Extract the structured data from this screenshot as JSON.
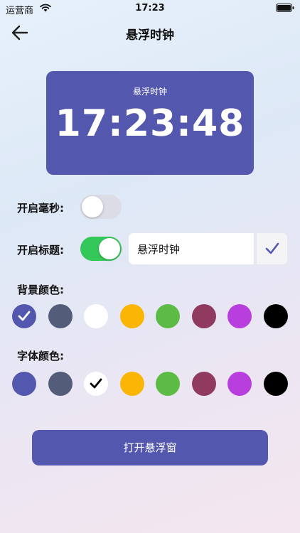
{
  "status_bar": {
    "carrier": "运营商",
    "time": "17:23"
  },
  "nav": {
    "title": "悬浮时钟"
  },
  "clock": {
    "title": "悬浮时钟",
    "time": "17:23:48"
  },
  "settings": {
    "milliseconds": {
      "label": "开启毫秒:",
      "on": false
    },
    "show_title": {
      "label": "开启标题:",
      "on": true,
      "input_value": "悬浮时钟"
    }
  },
  "background_color": {
    "label": "背景颜色:",
    "selected_index": 0,
    "colors": [
      "#5457ae",
      "#535c79",
      "#ffffff",
      "#fbb505",
      "#5cbb45",
      "#8f3a5e",
      "#b83ede",
      "#000000"
    ]
  },
  "font_color": {
    "label": "字体颜色:",
    "selected_index": 2,
    "colors": [
      "#5457ae",
      "#535c79",
      "#ffffff",
      "#fbb505",
      "#5cbb45",
      "#8f3a5e",
      "#b83ede",
      "#000000"
    ]
  },
  "open_button_label": "打开悬浮窗"
}
